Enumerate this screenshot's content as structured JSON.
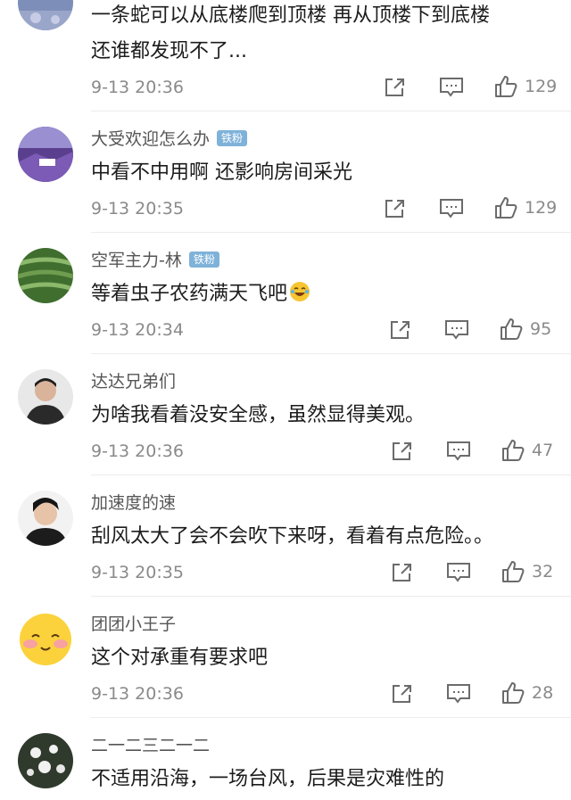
{
  "comments": [
    {
      "username": "",
      "badge": "",
      "lines": [
        "一条蛇可以从底楼爬到顶楼 再从顶楼下到底楼",
        "还谁都发现不了..."
      ],
      "time": "9-13 20:36",
      "likes": "129",
      "avatar_icon": "lavender-field-avatar"
    },
    {
      "username": "大受欢迎怎么办",
      "badge": "铁粉",
      "lines": [
        "中看不中用啊 还影响房间采光"
      ],
      "time": "9-13 20:35",
      "likes": "129",
      "avatar_icon": "purple-landscape-avatar"
    },
    {
      "username": "空军主力-林",
      "badge": "铁粉",
      "lines": [
        "等着虫子农药满天飞吧"
      ],
      "emoji": "laughing-tears-emoji",
      "time": "9-13 20:34",
      "likes": "95",
      "avatar_icon": "rice-terrace-avatar"
    },
    {
      "username": "达达兄弟们",
      "badge": "",
      "lines": [
        "为啥我看着没安全感，虽然显得美观。"
      ],
      "time": "9-13 20:36",
      "likes": "47",
      "avatar_icon": "man-portrait-avatar"
    },
    {
      "username": "加速度的速",
      "badge": "",
      "lines": [
        "刮风太大了会不会吹下来呀，看着有点危险。。"
      ],
      "time": "9-13 20:35",
      "likes": "32",
      "avatar_icon": "young-man-portrait-avatar"
    },
    {
      "username": "团团小王子",
      "badge": "",
      "lines": [
        "这个对承重有要求吧"
      ],
      "time": "9-13 20:36",
      "likes": "28",
      "avatar_icon": "yellow-smiley-avatar"
    },
    {
      "username": "二一二三二一二",
      "badge": "",
      "lines": [
        "不适用沿海，一场台风，后果是灾难性的"
      ],
      "time": "",
      "likes": "",
      "avatar_icon": "flowers-avatar"
    }
  ]
}
